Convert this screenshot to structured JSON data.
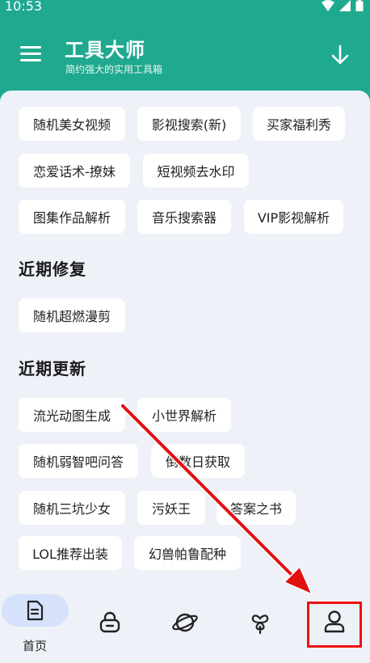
{
  "status_bar": {
    "time": "10:53"
  },
  "header": {
    "title": "工具大师",
    "subtitle": "简约强大的实用工具箱"
  },
  "tools_top": [
    "随机美女视频",
    "影视搜索(新)",
    "买家福利秀",
    "恋爱话术-撩妹",
    "短视频去水印",
    "图集作品解析",
    "音乐搜索器",
    "VIP影视解析"
  ],
  "recent_fix": {
    "title": "近期修复",
    "items": [
      "随机超燃漫剪"
    ]
  },
  "recent_update": {
    "title": "近期更新",
    "items": [
      "流光动图生成",
      "小世界解析",
      "随机弱智吧问答",
      "倒数日获取",
      "随机三坑少女",
      "污妖王",
      "答案之书",
      "LOL推荐出装",
      "幻兽帕鲁配种"
    ]
  },
  "bottom_nav": {
    "home_label": "首页"
  },
  "colors": {
    "primary": "#1fa98f",
    "background": "#eef1f8",
    "nav_active": "#d6e2fb",
    "annotation": "#e11111"
  }
}
